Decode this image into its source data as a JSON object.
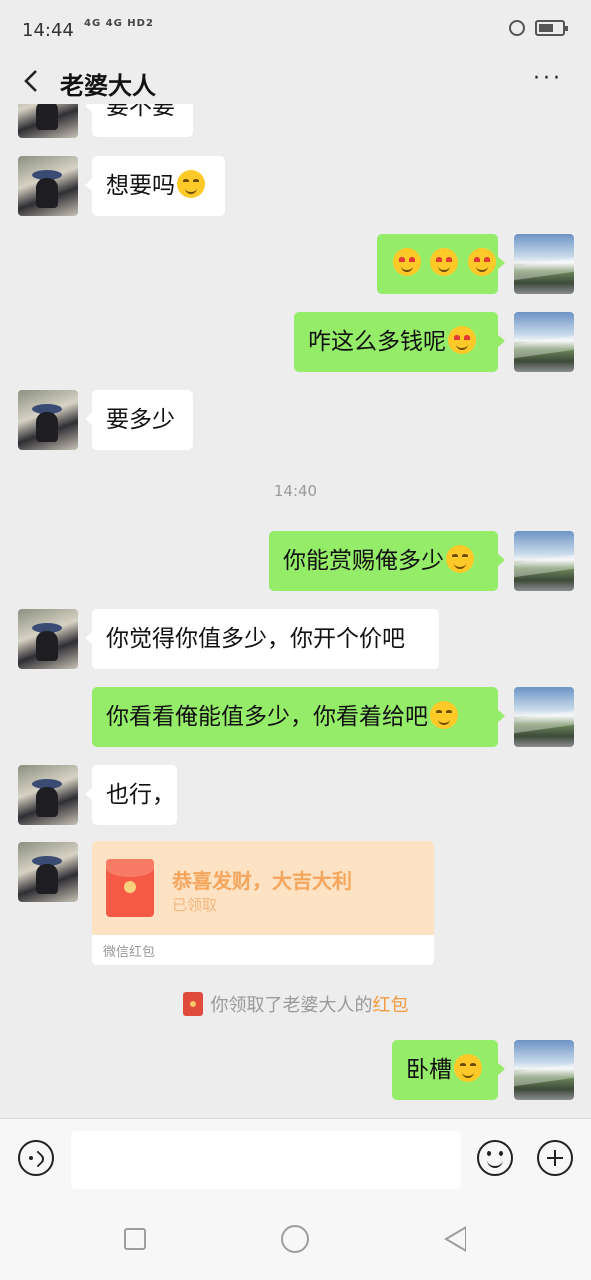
{
  "status_bar": {
    "time": "14:44",
    "signal": "4G 4G HD2"
  },
  "header": {
    "title": "老婆大人",
    "more_label": "···"
  },
  "messages": [
    {
      "from": "her",
      "text": "要不要"
    },
    {
      "from": "her",
      "text": "想要吗",
      "emoji": "smiling-face"
    },
    {
      "from": "me",
      "text": "",
      "emoji": "heart-eyes-x3"
    },
    {
      "from": "me",
      "text": "咋这么多钱呢",
      "emoji": "heart-eyes"
    },
    {
      "from": "her",
      "text": "要多少"
    },
    {
      "from": "me",
      "text": "你能赏赐俺多少",
      "emoji": "dizzy-face"
    },
    {
      "from": "her",
      "text": "你觉得你值多少，你开个价吧"
    },
    {
      "from": "me",
      "text": "你看看俺能值多少，你看着给吧",
      "emoji": "tears-of-joy"
    },
    {
      "from": "her",
      "text": "也行，"
    },
    {
      "from": "me",
      "text": "卧槽",
      "emoji": "dizzy-face"
    }
  ],
  "timestamp": "14:40",
  "red_packet": {
    "title": "恭喜发财，大吉大利",
    "status": "已领取",
    "footer": "微信红包"
  },
  "system_message": {
    "prefix": "你领取了老婆大人的",
    "highlight": "红包",
    "highlight_color": "#f39a3c"
  },
  "colors": {
    "outgoing_bubble": "#95ec69",
    "incoming_bubble": "#ffffff",
    "background": "#ededed"
  }
}
